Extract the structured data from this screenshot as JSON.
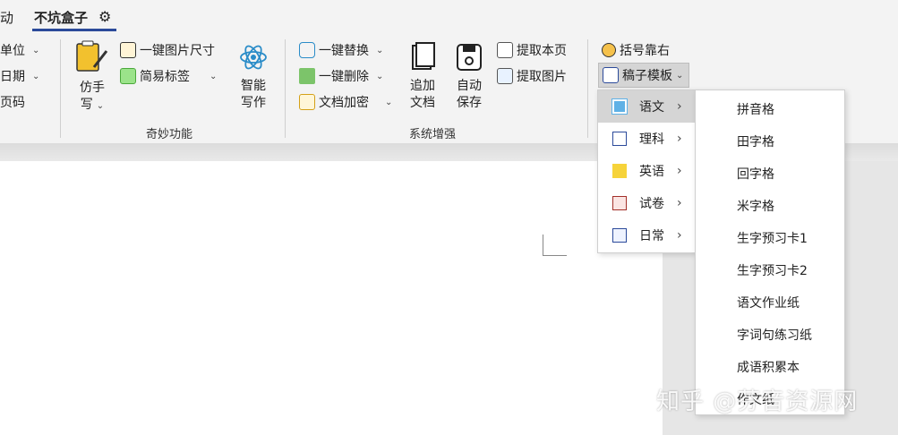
{
  "tabs": {
    "partial": "动",
    "active": "不坑盒子"
  },
  "col1": {
    "items": [
      "单位",
      "日期",
      "页码"
    ]
  },
  "group1": {
    "imitate_write": [
      "仿手",
      "写"
    ],
    "image_size": "一键图片尺寸",
    "simple_tag": "简易标签",
    "smart_write": [
      "智能",
      "写作"
    ],
    "label": "奇妙功能"
  },
  "group2": {
    "replace": "一键替换",
    "delete": "一键删除",
    "encrypt": "文档加密",
    "append_doc": [
      "追加",
      "文档"
    ],
    "auto_save": [
      "自动",
      "保存"
    ],
    "extract_page": "提取本页",
    "extract_image": "提取图片",
    "label": "系统增强"
  },
  "group3": {
    "bracket": "括号靠右",
    "template": "稿子模板"
  },
  "menu_primary": [
    "语文",
    "理科",
    "英语",
    "试卷",
    "日常"
  ],
  "menu_secondary": [
    "拼音格",
    "田字格",
    "回字格",
    "米字格",
    "生字预习卡1",
    "生字预习卡2",
    "语文作业纸",
    "字词句练习纸",
    "成语积累本",
    "作文纸"
  ],
  "watermark": "知乎 @芬音资源网",
  "colors": {
    "accent": "#2b4a9a",
    "menu_hover": "#d5d5d5"
  }
}
